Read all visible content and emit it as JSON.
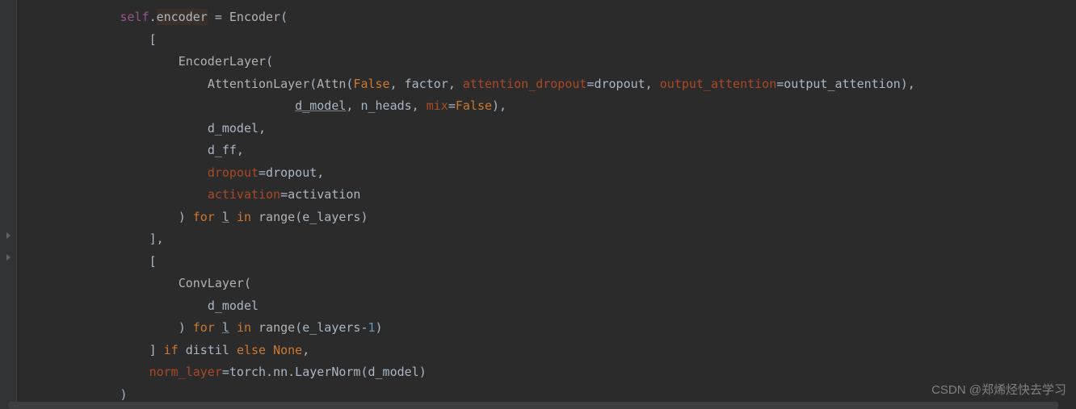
{
  "lines": [
    {
      "indent": 2,
      "segs": [
        {
          "t": "self",
          "cls": "c-self"
        },
        {
          "t": ".",
          "cls": "c-punc"
        },
        {
          "t": "encoder",
          "cls": "c-def hl-enc"
        },
        {
          "t": " = ",
          "cls": "c-op"
        },
        {
          "t": "Encoder",
          "cls": "c-call"
        },
        {
          "t": "(",
          "cls": "c-punc"
        }
      ]
    },
    {
      "indent": 3,
      "segs": [
        {
          "t": "[",
          "cls": "c-punc"
        }
      ]
    },
    {
      "indent": 4,
      "segs": [
        {
          "t": "EncoderLayer",
          "cls": "c-call"
        },
        {
          "t": "(",
          "cls": "c-punc"
        }
      ]
    },
    {
      "indent": 5,
      "segs": [
        {
          "t": "AttentionLayer",
          "cls": "c-call"
        },
        {
          "t": "(",
          "cls": "c-punc"
        },
        {
          "t": "Attn",
          "cls": "c-call"
        },
        {
          "t": "(",
          "cls": "c-punc"
        },
        {
          "t": "False",
          "cls": "c-kw"
        },
        {
          "t": ", factor, ",
          "cls": "c-def"
        },
        {
          "t": "attention_dropout",
          "cls": "c-kwarg"
        },
        {
          "t": "=dropout, ",
          "cls": "c-def"
        },
        {
          "t": "output_attention",
          "cls": "c-kwarg"
        },
        {
          "t": "=output_attention),",
          "cls": "c-def"
        }
      ]
    },
    {
      "indent": 8,
      "segs": [
        {
          "t": "d_model",
          "cls": "c-def underline"
        },
        {
          "t": ", n_heads, ",
          "cls": "c-def"
        },
        {
          "t": "mix",
          "cls": "c-kwarg"
        },
        {
          "t": "=",
          "cls": "c-def"
        },
        {
          "t": "False",
          "cls": "c-kw"
        },
        {
          "t": "),",
          "cls": "c-def"
        }
      ]
    },
    {
      "indent": 5,
      "segs": [
        {
          "t": "d_model,",
          "cls": "c-def"
        }
      ]
    },
    {
      "indent": 5,
      "segs": [
        {
          "t": "d_ff,",
          "cls": "c-def"
        }
      ]
    },
    {
      "indent": 5,
      "segs": [
        {
          "t": "dropout",
          "cls": "c-kwarg"
        },
        {
          "t": "=dropout,",
          "cls": "c-def"
        }
      ]
    },
    {
      "indent": 5,
      "segs": [
        {
          "t": "activation",
          "cls": "c-kwarg"
        },
        {
          "t": "=activation",
          "cls": "c-def"
        }
      ]
    },
    {
      "indent": 4,
      "segs": [
        {
          "t": ") ",
          "cls": "c-def"
        },
        {
          "t": "for ",
          "cls": "c-kw"
        },
        {
          "t": "l",
          "cls": "c-def underline"
        },
        {
          "t": " ",
          "cls": "c-def"
        },
        {
          "t": "in ",
          "cls": "c-kw"
        },
        {
          "t": "range",
          "cls": "c-call"
        },
        {
          "t": "(e_layers)",
          "cls": "c-def"
        }
      ]
    },
    {
      "indent": 3,
      "segs": [
        {
          "t": "],",
          "cls": "c-def"
        }
      ]
    },
    {
      "indent": 3,
      "segs": [
        {
          "t": "[",
          "cls": "c-punc"
        }
      ]
    },
    {
      "indent": 4,
      "segs": [
        {
          "t": "ConvLayer",
          "cls": "c-call"
        },
        {
          "t": "(",
          "cls": "c-punc"
        }
      ]
    },
    {
      "indent": 5,
      "segs": [
        {
          "t": "d_model",
          "cls": "c-def"
        }
      ]
    },
    {
      "indent": 4,
      "segs": [
        {
          "t": ") ",
          "cls": "c-def"
        },
        {
          "t": "for ",
          "cls": "c-kw"
        },
        {
          "t": "l",
          "cls": "c-def underline"
        },
        {
          "t": " ",
          "cls": "c-def"
        },
        {
          "t": "in ",
          "cls": "c-kw"
        },
        {
          "t": "range",
          "cls": "c-call"
        },
        {
          "t": "(e_layers-",
          "cls": "c-def"
        },
        {
          "t": "1",
          "cls": "c-num"
        },
        {
          "t": ")",
          "cls": "c-def"
        }
      ]
    },
    {
      "indent": 3,
      "segs": [
        {
          "t": "] ",
          "cls": "c-def"
        },
        {
          "t": "if ",
          "cls": "c-kw"
        },
        {
          "t": "distil ",
          "cls": "c-def"
        },
        {
          "t": "else ",
          "cls": "c-kw"
        },
        {
          "t": "None",
          "cls": "c-kw"
        },
        {
          "t": ",",
          "cls": "c-def"
        }
      ]
    },
    {
      "indent": 3,
      "segs": [
        {
          "t": "norm_layer",
          "cls": "c-kwarg"
        },
        {
          "t": "=torch.nn.LayerNorm(d_model)",
          "cls": "c-def"
        }
      ]
    },
    {
      "indent": 2,
      "segs": [
        {
          "t": ")",
          "cls": "c-def"
        }
      ]
    }
  ],
  "indent_unit": "    ",
  "base_indent": "      ",
  "watermark": "CSDN @郑烯烃快去学习",
  "fold_notches": [
    288,
    315
  ]
}
